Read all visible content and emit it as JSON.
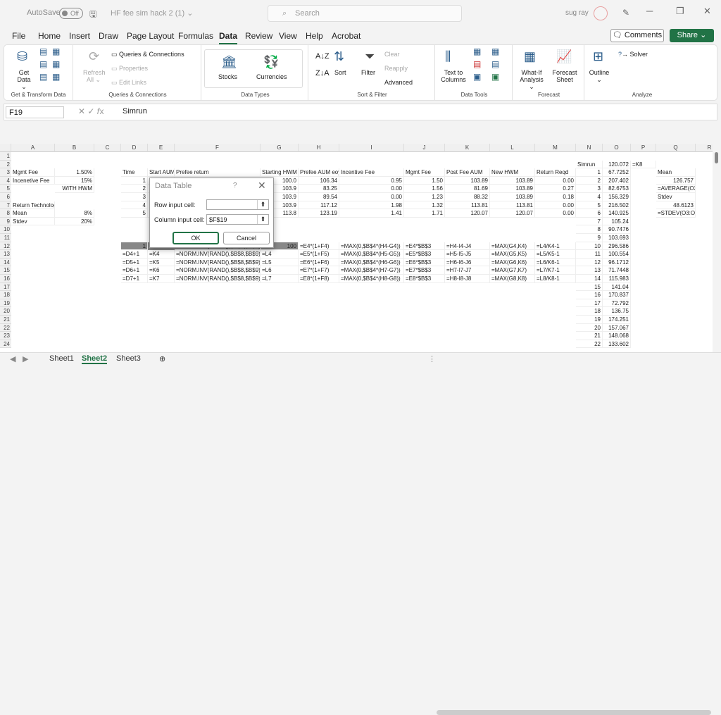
{
  "title": {
    "autosave": "AutoSave",
    "toggle": "Off",
    "filename": "HF fee sim hack 2 (1) ⌄",
    "search": "Search",
    "user": "sug ray"
  },
  "menu": [
    "File",
    "Home",
    "Insert",
    "Draw",
    "Page Layout",
    "Formulas",
    "Data",
    "Review",
    "View",
    "Help",
    "Acrobat"
  ],
  "buttons": {
    "comments": "Comments",
    "share": "Share"
  },
  "ribbon": {
    "get_data": "Get Data ⌄",
    "refresh": "Refresh All ⌄",
    "qc": "Queries & Connections",
    "properties": "Properties",
    "edit_links": "Edit Links",
    "stocks": "Stocks",
    "currencies": "Currencies",
    "sort": "Sort",
    "filter": "Filter",
    "clear": "Clear",
    "reapply": "Reapply",
    "advanced": "Advanced",
    "text_to_columns": "Text to Columns",
    "whatif": "What-If Analysis ⌄",
    "forecast_sheet": "Forecast Sheet",
    "outline": "Outline ⌄",
    "solver": "Solver",
    "groups": [
      "Get & Transform Data",
      "Queries & Connections",
      "Data Types",
      "Sort & Filter",
      "Data Tools",
      "Forecast",
      "Analyze"
    ]
  },
  "formula": {
    "namebox": "F19",
    "value": "Simrun"
  },
  "columns": [
    "A",
    "B",
    "C",
    "D",
    "E",
    "F",
    "G",
    "H",
    "I",
    "J",
    "K",
    "L",
    "M",
    "N",
    "O",
    "P",
    "Q",
    "R"
  ],
  "rows": [
    "1",
    "2",
    "3",
    "4",
    "5",
    "6",
    "7",
    "8",
    "9",
    "10",
    "11",
    "12",
    "13",
    "14",
    "15",
    "16",
    "17",
    "18",
    "19",
    "20",
    "21",
    "22",
    "23",
    "24"
  ],
  "cells": [
    {
      "c": "N",
      "r": 2,
      "v": "Simrun"
    },
    {
      "c": "O",
      "r": 2,
      "v": "120.072",
      "a": "r"
    },
    {
      "c": "P",
      "r": 2,
      "v": "=K8"
    },
    {
      "c": "A",
      "r": 3,
      "v": "Mgmt Fee"
    },
    {
      "c": "B",
      "r": 3,
      "v": "1.50%",
      "a": "r"
    },
    {
      "c": "D",
      "r": 3,
      "v": "Time"
    },
    {
      "c": "E",
      "r": 3,
      "v": "Start AUM"
    },
    {
      "c": "F",
      "r": 3,
      "v": "Prefee return"
    },
    {
      "c": "G",
      "r": 3,
      "v": "Starting HWM"
    },
    {
      "c": "H",
      "r": 3,
      "v": "Prefee AUM eoy"
    },
    {
      "c": "I",
      "r": 3,
      "v": "Incentive Fee"
    },
    {
      "c": "J",
      "r": 3,
      "v": "Mgmt Fee"
    },
    {
      "c": "K",
      "r": 3,
      "v": "Post Fee AUM"
    },
    {
      "c": "L",
      "r": 3,
      "v": "New HWM"
    },
    {
      "c": "M",
      "r": 3,
      "v": "Return Reqd"
    },
    {
      "c": "N",
      "r": 3,
      "v": "1",
      "a": "r"
    },
    {
      "c": "O",
      "r": 3,
      "v": "67.7252",
      "a": "r"
    },
    {
      "c": "Q",
      "r": 3,
      "v": "Mean"
    },
    {
      "c": "A",
      "r": 4,
      "v": "Incenetive Fee"
    },
    {
      "c": "B",
      "r": 4,
      "v": "15%",
      "a": "r"
    },
    {
      "c": "D",
      "r": 4,
      "v": "1",
      "a": "r"
    },
    {
      "c": "E",
      "r": 4,
      "v": "1",
      "a": "r"
    },
    {
      "c": "G",
      "r": 4,
      "v": "100.0",
      "a": "r"
    },
    {
      "c": "H",
      "r": 4,
      "v": "106.34",
      "a": "r"
    },
    {
      "c": "I",
      "r": 4,
      "v": "0.95",
      "a": "r"
    },
    {
      "c": "J",
      "r": 4,
      "v": "1.50",
      "a": "r"
    },
    {
      "c": "K",
      "r": 4,
      "v": "103.89",
      "a": "r"
    },
    {
      "c": "L",
      "r": 4,
      "v": "103.89",
      "a": "r"
    },
    {
      "c": "M",
      "r": 4,
      "v": "0.00",
      "a": "r"
    },
    {
      "c": "N",
      "r": 4,
      "v": "2",
      "a": "r"
    },
    {
      "c": "O",
      "r": 4,
      "v": "207.402",
      "a": "r"
    },
    {
      "c": "Q",
      "r": 4,
      "v": "126.757",
      "a": "r"
    },
    {
      "c": "B",
      "r": 5,
      "v": "WITH HWM",
      "a": "r"
    },
    {
      "c": "D",
      "r": 5,
      "v": "2",
      "a": "r"
    },
    {
      "c": "E",
      "r": 5,
      "v": "1",
      "a": "r"
    },
    {
      "c": "G",
      "r": 5,
      "v": "103.9",
      "a": "r"
    },
    {
      "c": "H",
      "r": 5,
      "v": "83.25",
      "a": "r"
    },
    {
      "c": "I",
      "r": 5,
      "v": "0.00",
      "a": "r"
    },
    {
      "c": "J",
      "r": 5,
      "v": "1.56",
      "a": "r"
    },
    {
      "c": "K",
      "r": 5,
      "v": "81.69",
      "a": "r"
    },
    {
      "c": "L",
      "r": 5,
      "v": "103.89",
      "a": "r"
    },
    {
      "c": "M",
      "r": 5,
      "v": "0.27",
      "a": "r"
    },
    {
      "c": "N",
      "r": 5,
      "v": "3",
      "a": "r"
    },
    {
      "c": "O",
      "r": 5,
      "v": "82.6753",
      "a": "r"
    },
    {
      "c": "Q",
      "r": 5,
      "v": "=AVERAGE(O3:O11002)"
    },
    {
      "c": "D",
      "r": 6,
      "v": "3",
      "a": "r"
    },
    {
      "c": "G",
      "r": 6,
      "v": "103.9",
      "a": "r"
    },
    {
      "c": "H",
      "r": 6,
      "v": "89.54",
      "a": "r"
    },
    {
      "c": "I",
      "r": 6,
      "v": "0.00",
      "a": "r"
    },
    {
      "c": "J",
      "r": 6,
      "v": "1.23",
      "a": "r"
    },
    {
      "c": "K",
      "r": 6,
      "v": "88.32",
      "a": "r"
    },
    {
      "c": "L",
      "r": 6,
      "v": "103.89",
      "a": "r"
    },
    {
      "c": "M",
      "r": 6,
      "v": "0.18",
      "a": "r"
    },
    {
      "c": "N",
      "r": 6,
      "v": "4",
      "a": "r"
    },
    {
      "c": "O",
      "r": 6,
      "v": "156.329",
      "a": "r"
    },
    {
      "c": "Q",
      "r": 6,
      "v": "Stdev"
    },
    {
      "c": "A",
      "r": 7,
      "v": "Return Technology"
    },
    {
      "c": "D",
      "r": 7,
      "v": "4",
      "a": "r"
    },
    {
      "c": "G",
      "r": 7,
      "v": "103.9",
      "a": "r"
    },
    {
      "c": "H",
      "r": 7,
      "v": "117.12",
      "a": "r"
    },
    {
      "c": "I",
      "r": 7,
      "v": "1.98",
      "a": "r"
    },
    {
      "c": "J",
      "r": 7,
      "v": "1.32",
      "a": "r"
    },
    {
      "c": "K",
      "r": 7,
      "v": "113.81",
      "a": "r"
    },
    {
      "c": "L",
      "r": 7,
      "v": "113.81",
      "a": "r"
    },
    {
      "c": "M",
      "r": 7,
      "v": "0.00",
      "a": "r"
    },
    {
      "c": "N",
      "r": 7,
      "v": "5",
      "a": "r"
    },
    {
      "c": "O",
      "r": 7,
      "v": "216.502",
      "a": "r"
    },
    {
      "c": "Q",
      "r": 7,
      "v": "48.6123",
      "a": "r"
    },
    {
      "c": "A",
      "r": 8,
      "v": "Mean"
    },
    {
      "c": "B",
      "r": 8,
      "v": "8%",
      "a": "r"
    },
    {
      "c": "D",
      "r": 8,
      "v": "5",
      "a": "r"
    },
    {
      "c": "E",
      "r": 8,
      "v": "1",
      "a": "r"
    },
    {
      "c": "G",
      "r": 8,
      "v": "113.8",
      "a": "r"
    },
    {
      "c": "H",
      "r": 8,
      "v": "123.19",
      "a": "r"
    },
    {
      "c": "I",
      "r": 8,
      "v": "1.41",
      "a": "r"
    },
    {
      "c": "J",
      "r": 8,
      "v": "1.71",
      "a": "r"
    },
    {
      "c": "K",
      "r": 8,
      "v": "120.07",
      "a": "r"
    },
    {
      "c": "L",
      "r": 8,
      "v": "120.07",
      "a": "r"
    },
    {
      "c": "M",
      "r": 8,
      "v": "0.00",
      "a": "r"
    },
    {
      "c": "N",
      "r": 8,
      "v": "6",
      "a": "r"
    },
    {
      "c": "O",
      "r": 8,
      "v": "140.925",
      "a": "r"
    },
    {
      "c": "Q",
      "r": 8,
      "v": "=STDEV(O3:O11002)"
    },
    {
      "c": "A",
      "r": 9,
      "v": "Stdev"
    },
    {
      "c": "B",
      "r": 9,
      "v": "20%",
      "a": "r"
    },
    {
      "c": "N",
      "r": 9,
      "v": "7",
      "a": "r"
    },
    {
      "c": "O",
      "r": 9,
      "v": "105.24",
      "a": "r"
    },
    {
      "c": "N",
      "r": 10,
      "v": "8",
      "a": "r"
    },
    {
      "c": "O",
      "r": 10,
      "v": "90.7476",
      "a": "r"
    },
    {
      "c": "N",
      "r": 11,
      "v": "9",
      "a": "r"
    },
    {
      "c": "O",
      "r": 11,
      "v": "103.693",
      "a": "r"
    },
    {
      "c": "D",
      "r": 12,
      "v": "1",
      "a": "r"
    },
    {
      "c": "F",
      "r": 12,
      "v": "=NORM.INV(RAND(),$B$8,$B$9)"
    },
    {
      "c": "G",
      "r": 12,
      "v": "100",
      "a": "r"
    },
    {
      "c": "H",
      "r": 12,
      "v": "=E4*(1+F4)"
    },
    {
      "c": "I",
      "r": 12,
      "v": "=MAX(0,$B$4*(H4-G4))"
    },
    {
      "c": "J",
      "r": 12,
      "v": "=E4*$B$3"
    },
    {
      "c": "K",
      "r": 12,
      "v": "=H4-I4-J4"
    },
    {
      "c": "L",
      "r": 12,
      "v": "=MAX(G4,K4)"
    },
    {
      "c": "M",
      "r": 12,
      "v": "=L4/K4-1"
    },
    {
      "c": "N",
      "r": 12,
      "v": "10",
      "a": "r"
    },
    {
      "c": "O",
      "r": 12,
      "v": "296.586",
      "a": "r"
    },
    {
      "c": "D",
      "r": 13,
      "v": "=D4+1"
    },
    {
      "c": "E",
      "r": 13,
      "v": "=K4"
    },
    {
      "c": "F",
      "r": 13,
      "v": "=NORM.INV(RAND(),$B$8,$B$9)"
    },
    {
      "c": "G",
      "r": 13,
      "v": "=L4"
    },
    {
      "c": "H",
      "r": 13,
      "v": "=E5*(1+F5)"
    },
    {
      "c": "I",
      "r": 13,
      "v": "=MAX(0,$B$4*(H5-G5))"
    },
    {
      "c": "J",
      "r": 13,
      "v": "=E5*$B$3"
    },
    {
      "c": "K",
      "r": 13,
      "v": "=H5-I5-J5"
    },
    {
      "c": "L",
      "r": 13,
      "v": "=MAX(G5,K5)"
    },
    {
      "c": "M",
      "r": 13,
      "v": "=L5/K5-1"
    },
    {
      "c": "N",
      "r": 13,
      "v": "11",
      "a": "r"
    },
    {
      "c": "O",
      "r": 13,
      "v": "100.554",
      "a": "r"
    },
    {
      "c": "D",
      "r": 14,
      "v": "=D5+1"
    },
    {
      "c": "E",
      "r": 14,
      "v": "=K5"
    },
    {
      "c": "F",
      "r": 14,
      "v": "=NORM.INV(RAND(),$B$8,$B$9)"
    },
    {
      "c": "G",
      "r": 14,
      "v": "=L5"
    },
    {
      "c": "H",
      "r": 14,
      "v": "=E6*(1+F6)"
    },
    {
      "c": "I",
      "r": 14,
      "v": "=MAX(0,$B$4*(H6-G6))"
    },
    {
      "c": "J",
      "r": 14,
      "v": "=E6*$B$3"
    },
    {
      "c": "K",
      "r": 14,
      "v": "=H6-I6-J6"
    },
    {
      "c": "L",
      "r": 14,
      "v": "=MAX(G6,K6)"
    },
    {
      "c": "M",
      "r": 14,
      "v": "=L6/K6-1"
    },
    {
      "c": "N",
      "r": 14,
      "v": "12",
      "a": "r"
    },
    {
      "c": "O",
      "r": 14,
      "v": "96.1712",
      "a": "r"
    },
    {
      "c": "D",
      "r": 15,
      "v": "=D6+1"
    },
    {
      "c": "E",
      "r": 15,
      "v": "=K6"
    },
    {
      "c": "F",
      "r": 15,
      "v": "=NORM.INV(RAND(),$B$8,$B$9)"
    },
    {
      "c": "G",
      "r": 15,
      "v": "=L6"
    },
    {
      "c": "H",
      "r": 15,
      "v": "=E7*(1+F7)"
    },
    {
      "c": "I",
      "r": 15,
      "v": "=MAX(0,$B$4*(H7-G7))"
    },
    {
      "c": "J",
      "r": 15,
      "v": "=E7*$B$3"
    },
    {
      "c": "K",
      "r": 15,
      "v": "=H7-I7-J7"
    },
    {
      "c": "L",
      "r": 15,
      "v": "=MAX(G7,K7)"
    },
    {
      "c": "M",
      "r": 15,
      "v": "=L7/K7-1"
    },
    {
      "c": "N",
      "r": 15,
      "v": "13",
      "a": "r"
    },
    {
      "c": "O",
      "r": 15,
      "v": "71.7448",
      "a": "r"
    },
    {
      "c": "D",
      "r": 16,
      "v": "=D7+1"
    },
    {
      "c": "E",
      "r": 16,
      "v": "=K7"
    },
    {
      "c": "F",
      "r": 16,
      "v": "=NORM.INV(RAND(),$B$8,$B$9)"
    },
    {
      "c": "G",
      "r": 16,
      "v": "=L7"
    },
    {
      "c": "H",
      "r": 16,
      "v": "=E8*(1+F8)"
    },
    {
      "c": "I",
      "r": 16,
      "v": "=MAX(0,$B$4*(H8-G8))"
    },
    {
      "c": "J",
      "r": 16,
      "v": "=E8*$B$3"
    },
    {
      "c": "K",
      "r": 16,
      "v": "=H8-I8-J8"
    },
    {
      "c": "L",
      "r": 16,
      "v": "=MAX(G8,K8)"
    },
    {
      "c": "M",
      "r": 16,
      "v": "=L8/K8-1"
    },
    {
      "c": "N",
      "r": 16,
      "v": "14",
      "a": "r"
    },
    {
      "c": "O",
      "r": 16,
      "v": "115.983",
      "a": "r"
    },
    {
      "c": "N",
      "r": 17,
      "v": "15",
      "a": "r"
    },
    {
      "c": "O",
      "r": 17,
      "v": "141.04",
      "a": "r"
    },
    {
      "c": "N",
      "r": 18,
      "v": "16",
      "a": "r"
    },
    {
      "c": "O",
      "r": 18,
      "v": "170.837",
      "a": "r"
    },
    {
      "c": "N",
      "r": 19,
      "v": "17",
      "a": "r"
    },
    {
      "c": "O",
      "r": 19,
      "v": "72.792",
      "a": "r"
    },
    {
      "c": "N",
      "r": 20,
      "v": "18",
      "a": "r"
    },
    {
      "c": "O",
      "r": 20,
      "v": "136.75",
      "a": "r"
    },
    {
      "c": "N",
      "r": 21,
      "v": "19",
      "a": "r"
    },
    {
      "c": "O",
      "r": 21,
      "v": "174.251",
      "a": "r"
    },
    {
      "c": "N",
      "r": 22,
      "v": "20",
      "a": "r"
    },
    {
      "c": "O",
      "r": 22,
      "v": "157.067",
      "a": "r"
    },
    {
      "c": "N",
      "r": 23,
      "v": "21",
      "a": "r"
    },
    {
      "c": "O",
      "r": 23,
      "v": "148.068",
      "a": "r"
    },
    {
      "c": "N",
      "r": 24,
      "v": "22",
      "a": "r"
    },
    {
      "c": "O",
      "r": 24,
      "v": "133.602",
      "a": "r"
    }
  ],
  "dialog": {
    "title": "Data Table",
    "help": "?",
    "close": "✕",
    "row_label": "Row input cell:",
    "row_value": "",
    "col_label": "Column input cell:",
    "col_value": "$F$19",
    "ok": "OK",
    "cancel": "Cancel"
  },
  "sheets": [
    "Sheet1",
    "Sheet2",
    "Sheet3"
  ],
  "active_sheet": "Sheet2",
  "accent": "#217346"
}
